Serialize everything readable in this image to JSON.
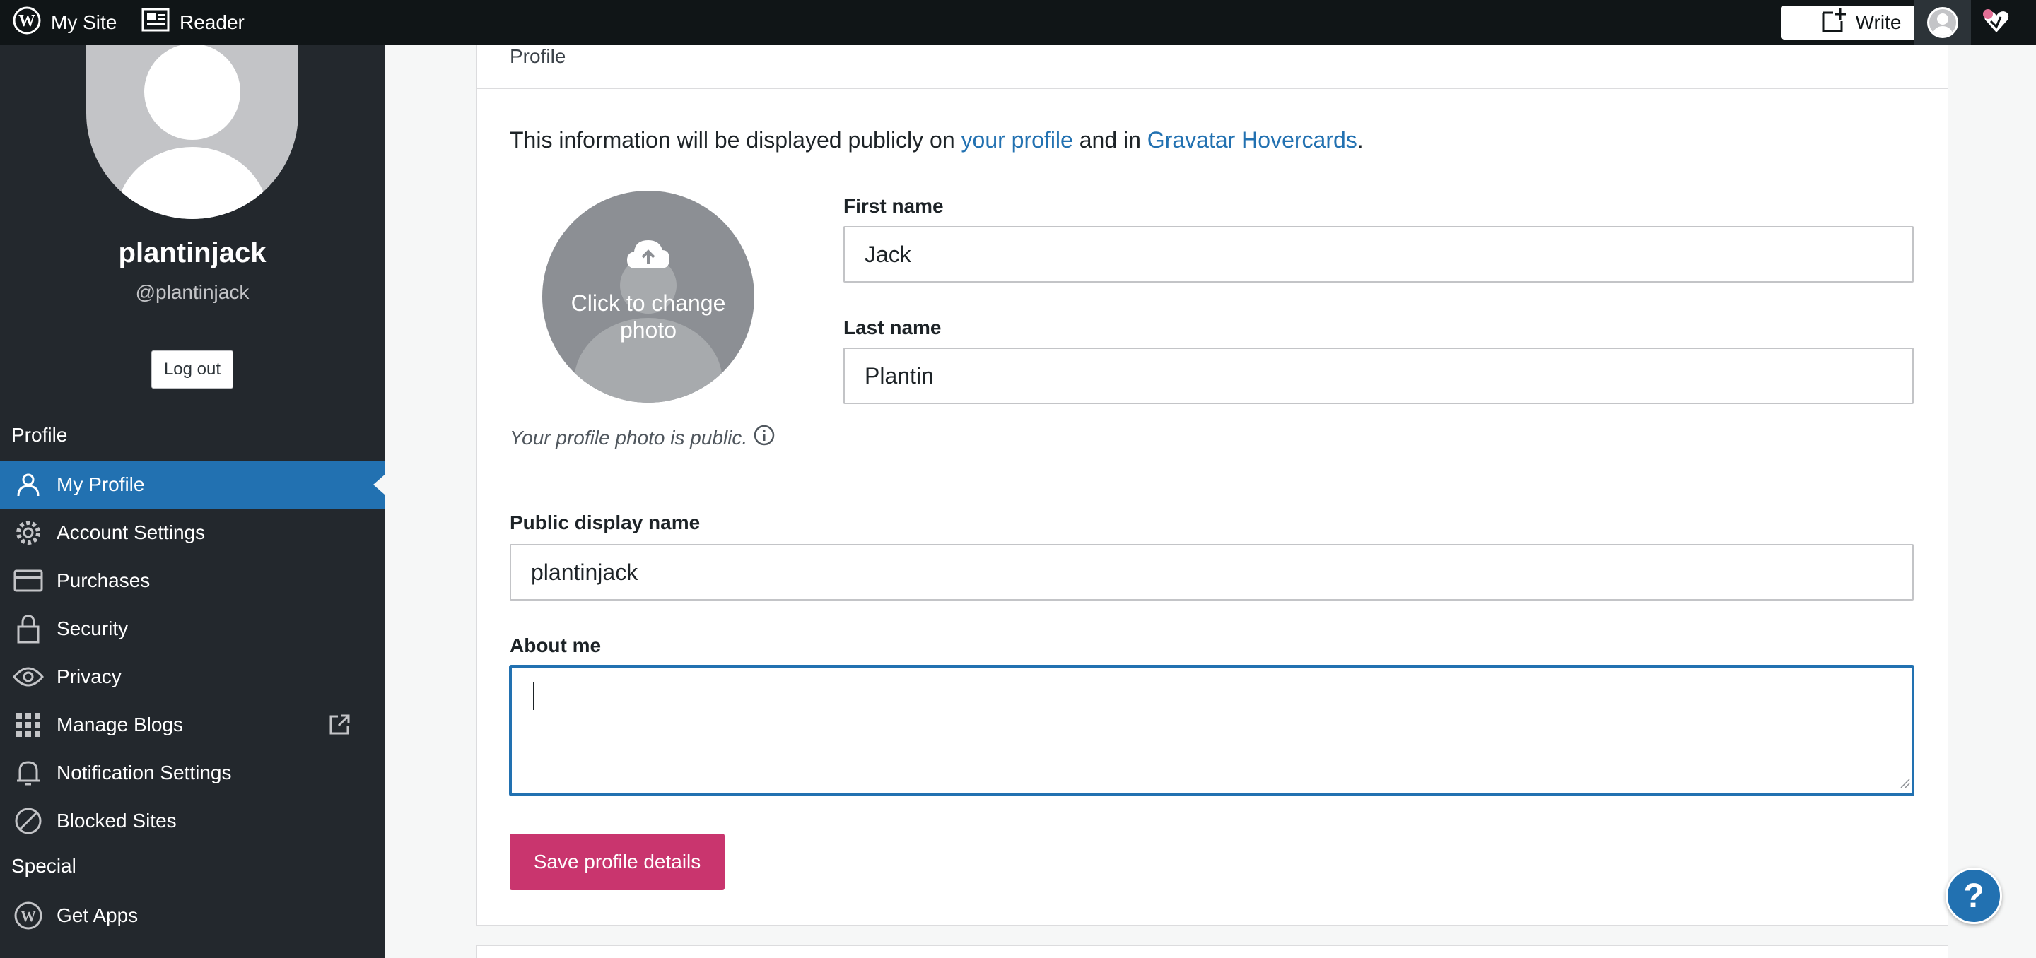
{
  "masterbar": {
    "my_site_label": "My Site",
    "reader_label": "Reader",
    "write_label": "Write"
  },
  "sidebar": {
    "username": "plantinjack",
    "handle": "@plantinjack",
    "logout_label": "Log out",
    "profile_heading": "Profile",
    "special_heading": "Special",
    "items": [
      {
        "label": "My Profile",
        "icon": "person-icon",
        "active": true
      },
      {
        "label": "Account Settings",
        "icon": "gear-icon"
      },
      {
        "label": "Purchases",
        "icon": "credit-card-icon"
      },
      {
        "label": "Security",
        "icon": "lock-icon"
      },
      {
        "label": "Privacy",
        "icon": "eye-icon"
      },
      {
        "label": "Manage Blogs",
        "icon": "grid-icon"
      },
      {
        "label": "Notification Settings",
        "icon": "bell-icon"
      },
      {
        "label": "Blocked Sites",
        "icon": "block-icon"
      }
    ],
    "special_items": [
      {
        "label": "Get Apps",
        "icon": "wordpress-icon"
      }
    ]
  },
  "main": {
    "section_title": "Profile",
    "info_prefix": "This information will be displayed publicly on ",
    "info_link1": "your profile",
    "info_middle": " and in ",
    "info_link2": "Gravatar Hovercards",
    "info_suffix": ".",
    "photo_text": "Click to change photo",
    "photo_public_note": "Your profile photo is public.",
    "first_name_label": "First name",
    "first_name_value": "Jack",
    "last_name_label": "Last name",
    "last_name_value": "Plantin",
    "display_name_label": "Public display name",
    "display_name_value": "plantinjack",
    "about_label": "About me",
    "about_value": "",
    "save_label": "Save profile details"
  },
  "help_label": "?",
  "colors": {
    "masterbar_bg": "#101517",
    "sidebar_bg": "#23282d",
    "active_blue": "#2271b1",
    "save_pink": "#c9356e"
  }
}
